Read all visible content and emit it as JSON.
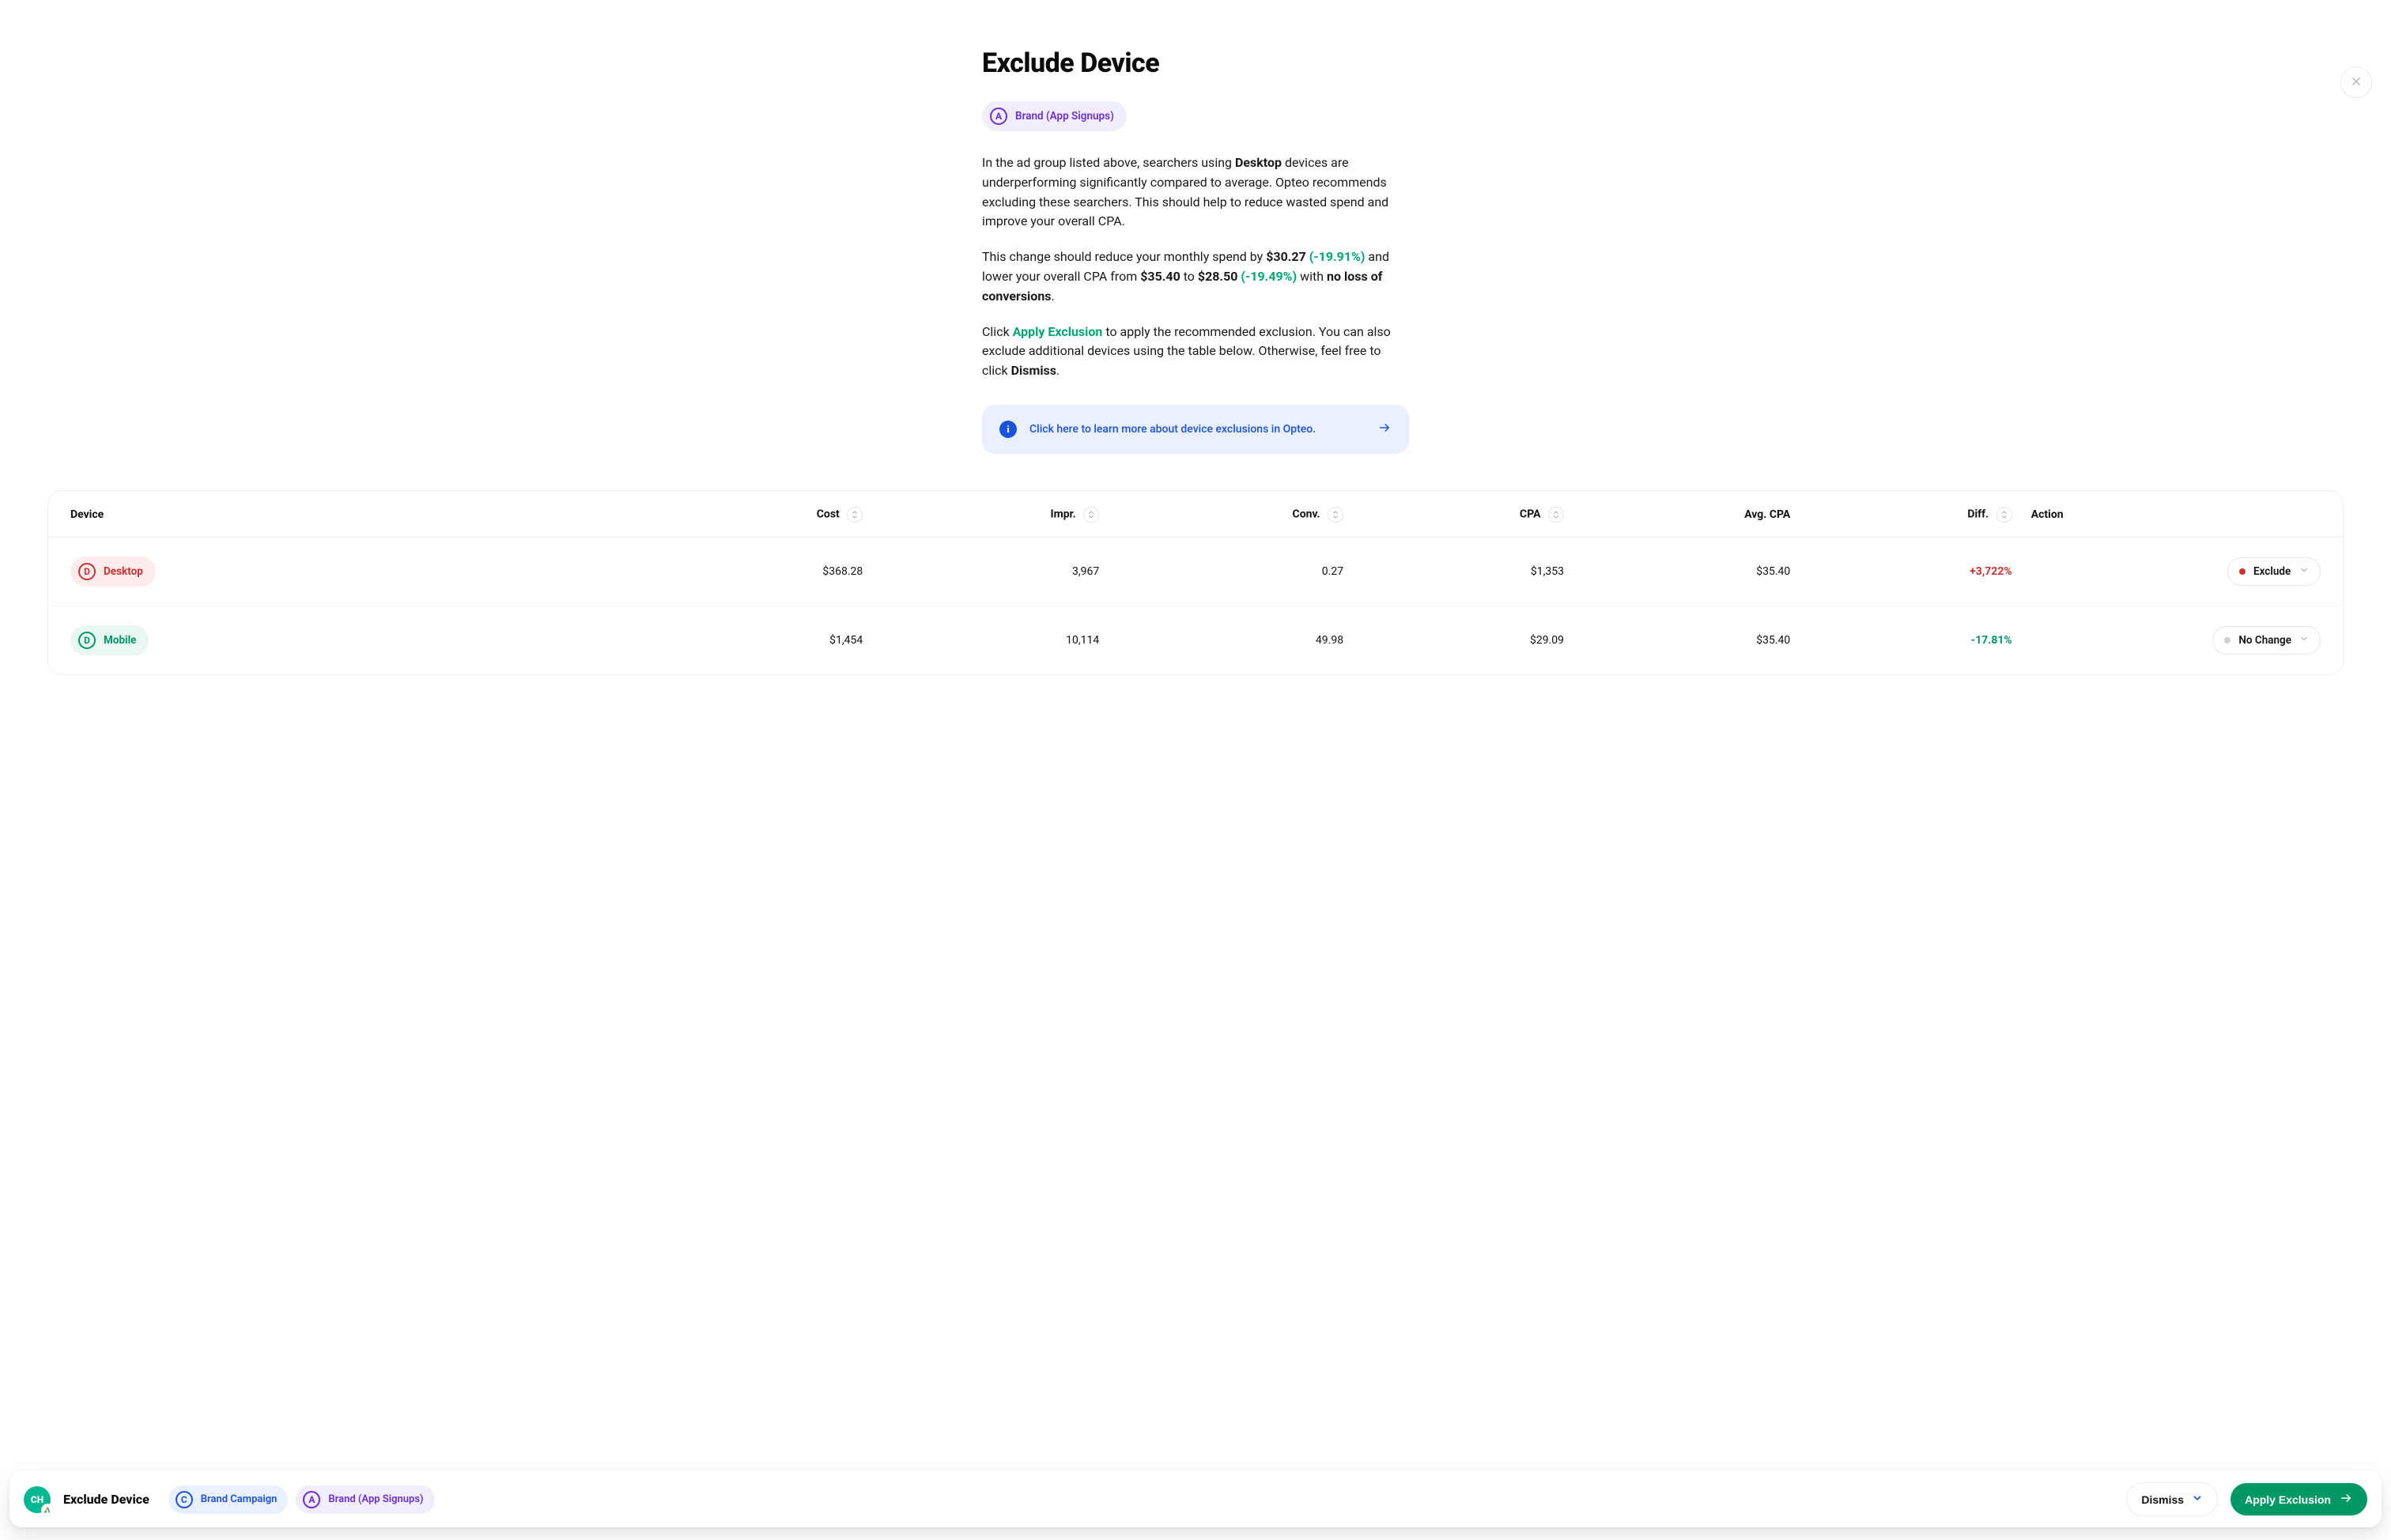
{
  "close_label": "Close",
  "title": "Exclude Device",
  "campaign_chip": {
    "letter": "A",
    "label": "Brand (App Signups)"
  },
  "paragraphs": {
    "p1": {
      "seg1": "In the ad group listed above, searchers using ",
      "bold1": "Desktop",
      "seg2": " devices are underperforming significantly compared to average. Opteo recommends excluding these searchers. This should help to reduce wasted spend and improve your overall CPA."
    },
    "p2": {
      "seg1": "This change should reduce your monthly spend by ",
      "bold1": "$30.27",
      "green1": " (-19.91%)",
      "seg2": " and lower your overall CPA from ",
      "bold2": "$35.40",
      "seg3": " to ",
      "bold3": "$28.50",
      "green2": " (-19.49%)",
      "seg4": " with ",
      "bold4": "no loss of conversions",
      "seg5": "."
    },
    "p3": {
      "seg1": "Click ",
      "green_link": "Apply Exclusion",
      "seg2": " to apply the recommended exclusion. You can also exclude additional devices using the table below. Otherwise, feel free to click ",
      "bold1": "Dismiss",
      "seg3": "."
    }
  },
  "learn_more": {
    "text": "Click here to learn more about device exclusions in Opteo."
  },
  "table": {
    "headers": {
      "device": "Device",
      "cost": "Cost",
      "impr": "Impr.",
      "conv": "Conv.",
      "cpa": "CPA",
      "avg_cpa": "Avg. CPA",
      "diff": "Diff.",
      "action": "Action"
    },
    "rows": [
      {
        "device_letter": "D",
        "device_label": "Desktop",
        "device_tone": "red",
        "cost": "$368.28",
        "impr": "3,967",
        "conv": "0.27",
        "cpa": "$1,353",
        "avg_cpa": "$35.40",
        "diff": "+3,722%",
        "diff_tone": "pos",
        "action": "Exclude",
        "action_dot": "red"
      },
      {
        "device_letter": "D",
        "device_label": "Mobile",
        "device_tone": "green",
        "cost": "$1,454",
        "impr": "10,114",
        "conv": "49.98",
        "cpa": "$29.09",
        "avg_cpa": "$35.40",
        "diff": "-17.81%",
        "diff_tone": "neg",
        "action": "No Change",
        "action_dot": "grey"
      }
    ]
  },
  "bottom": {
    "avatar_initials": "CH",
    "title": "Exclude Device",
    "chips": [
      {
        "letter": "C",
        "label": "Brand Campaign",
        "color": "blue"
      },
      {
        "letter": "A",
        "label": "Brand (App Signups)",
        "color": "purple"
      }
    ],
    "dismiss": "Dismiss",
    "apply": "Apply Exclusion"
  }
}
